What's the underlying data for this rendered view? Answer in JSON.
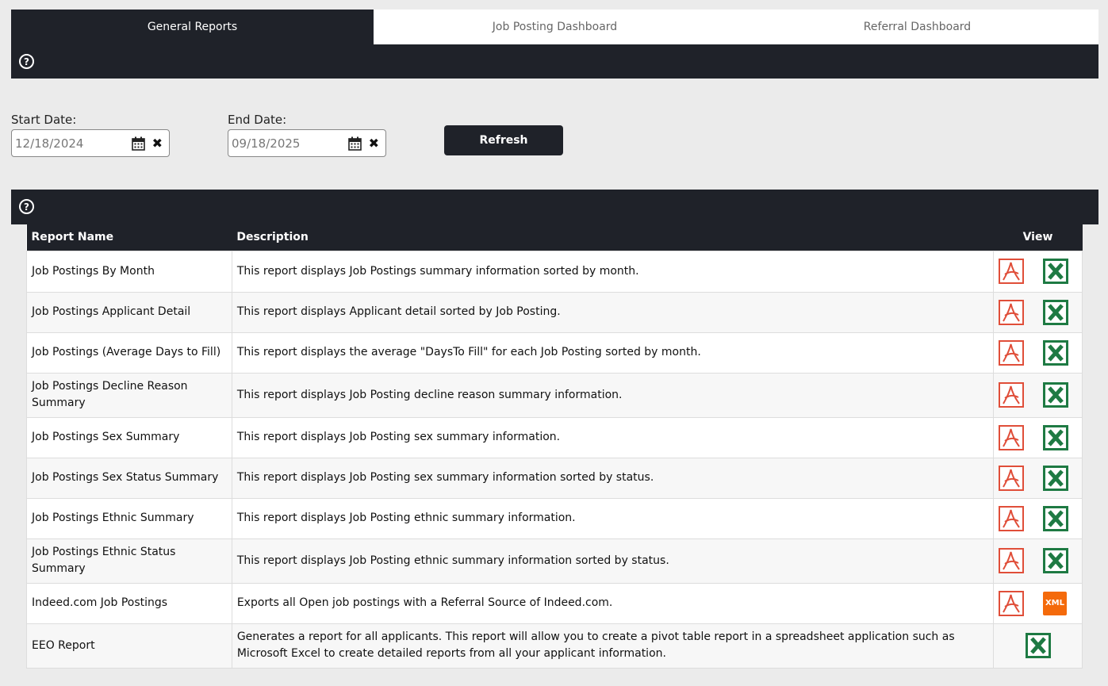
{
  "tabs": [
    {
      "label": "General Reports",
      "active": true
    },
    {
      "label": "Job Posting Dashboard",
      "active": false
    },
    {
      "label": "Referral Dashboard",
      "active": false
    }
  ],
  "filters": {
    "start_label": "Start Date:",
    "start_value": "12/18/2024",
    "end_label": "End Date:",
    "end_value": "09/18/2025",
    "refresh_label": "Refresh"
  },
  "help_glyph": "?",
  "table": {
    "headers": {
      "name": "Report Name",
      "description": "Description",
      "view": "View"
    },
    "rows": [
      {
        "name": "Job Postings By Month",
        "description": "This report displays Job Postings summary information sorted by month.",
        "icons": [
          "pdf-icon",
          "excel-icon"
        ]
      },
      {
        "name": "Job Postings Applicant Detail",
        "description": "This report displays Applicant detail sorted by Job Posting.",
        "icons": [
          "pdf-icon",
          "excel-icon"
        ]
      },
      {
        "name": "Job Postings (Average Days to Fill)",
        "description": "This report displays the average \"DaysTo Fill\" for each Job Posting sorted by month.",
        "icons": [
          "pdf-icon",
          "excel-icon"
        ]
      },
      {
        "name": "Job Postings Decline Reason Summary",
        "description": "This report displays Job Posting decline reason summary information.",
        "icons": [
          "pdf-icon",
          "excel-icon"
        ]
      },
      {
        "name": "Job Postings Sex Summary",
        "description": "This report displays Job Posting sex summary information.",
        "icons": [
          "pdf-icon",
          "excel-icon"
        ]
      },
      {
        "name": "Job Postings Sex Status Summary",
        "description": "This report displays Job Posting sex summary information sorted by status.",
        "icons": [
          "pdf-icon",
          "excel-icon"
        ]
      },
      {
        "name": "Job Postings Ethnic Summary",
        "description": "This report displays Job Posting ethnic summary information.",
        "icons": [
          "pdf-icon",
          "excel-icon"
        ]
      },
      {
        "name": "Job Postings Ethnic Status Summary",
        "description": "This report displays Job Posting ethnic summary information sorted by status.",
        "icons": [
          "pdf-icon",
          "excel-icon"
        ]
      },
      {
        "name": "Indeed.com Job Postings",
        "description": "Exports all Open job postings with a Referral Source of Indeed.com.",
        "icons": [
          "pdf-icon",
          "xml-icon"
        ]
      },
      {
        "name": "EEO Report",
        "description": "Generates a report for all applicants. This report will allow you to create a pivot table report in a spreadsheet application such as Microsoft Excel to create detailed reports from all your applicant information.",
        "icons": [
          "excel-icon"
        ]
      }
    ]
  },
  "xml_label": "XML",
  "colors": {
    "dark": "#1f2229",
    "pdf": "#e04e39",
    "excel": "#1e7a43",
    "xml": "#f46a0b"
  }
}
